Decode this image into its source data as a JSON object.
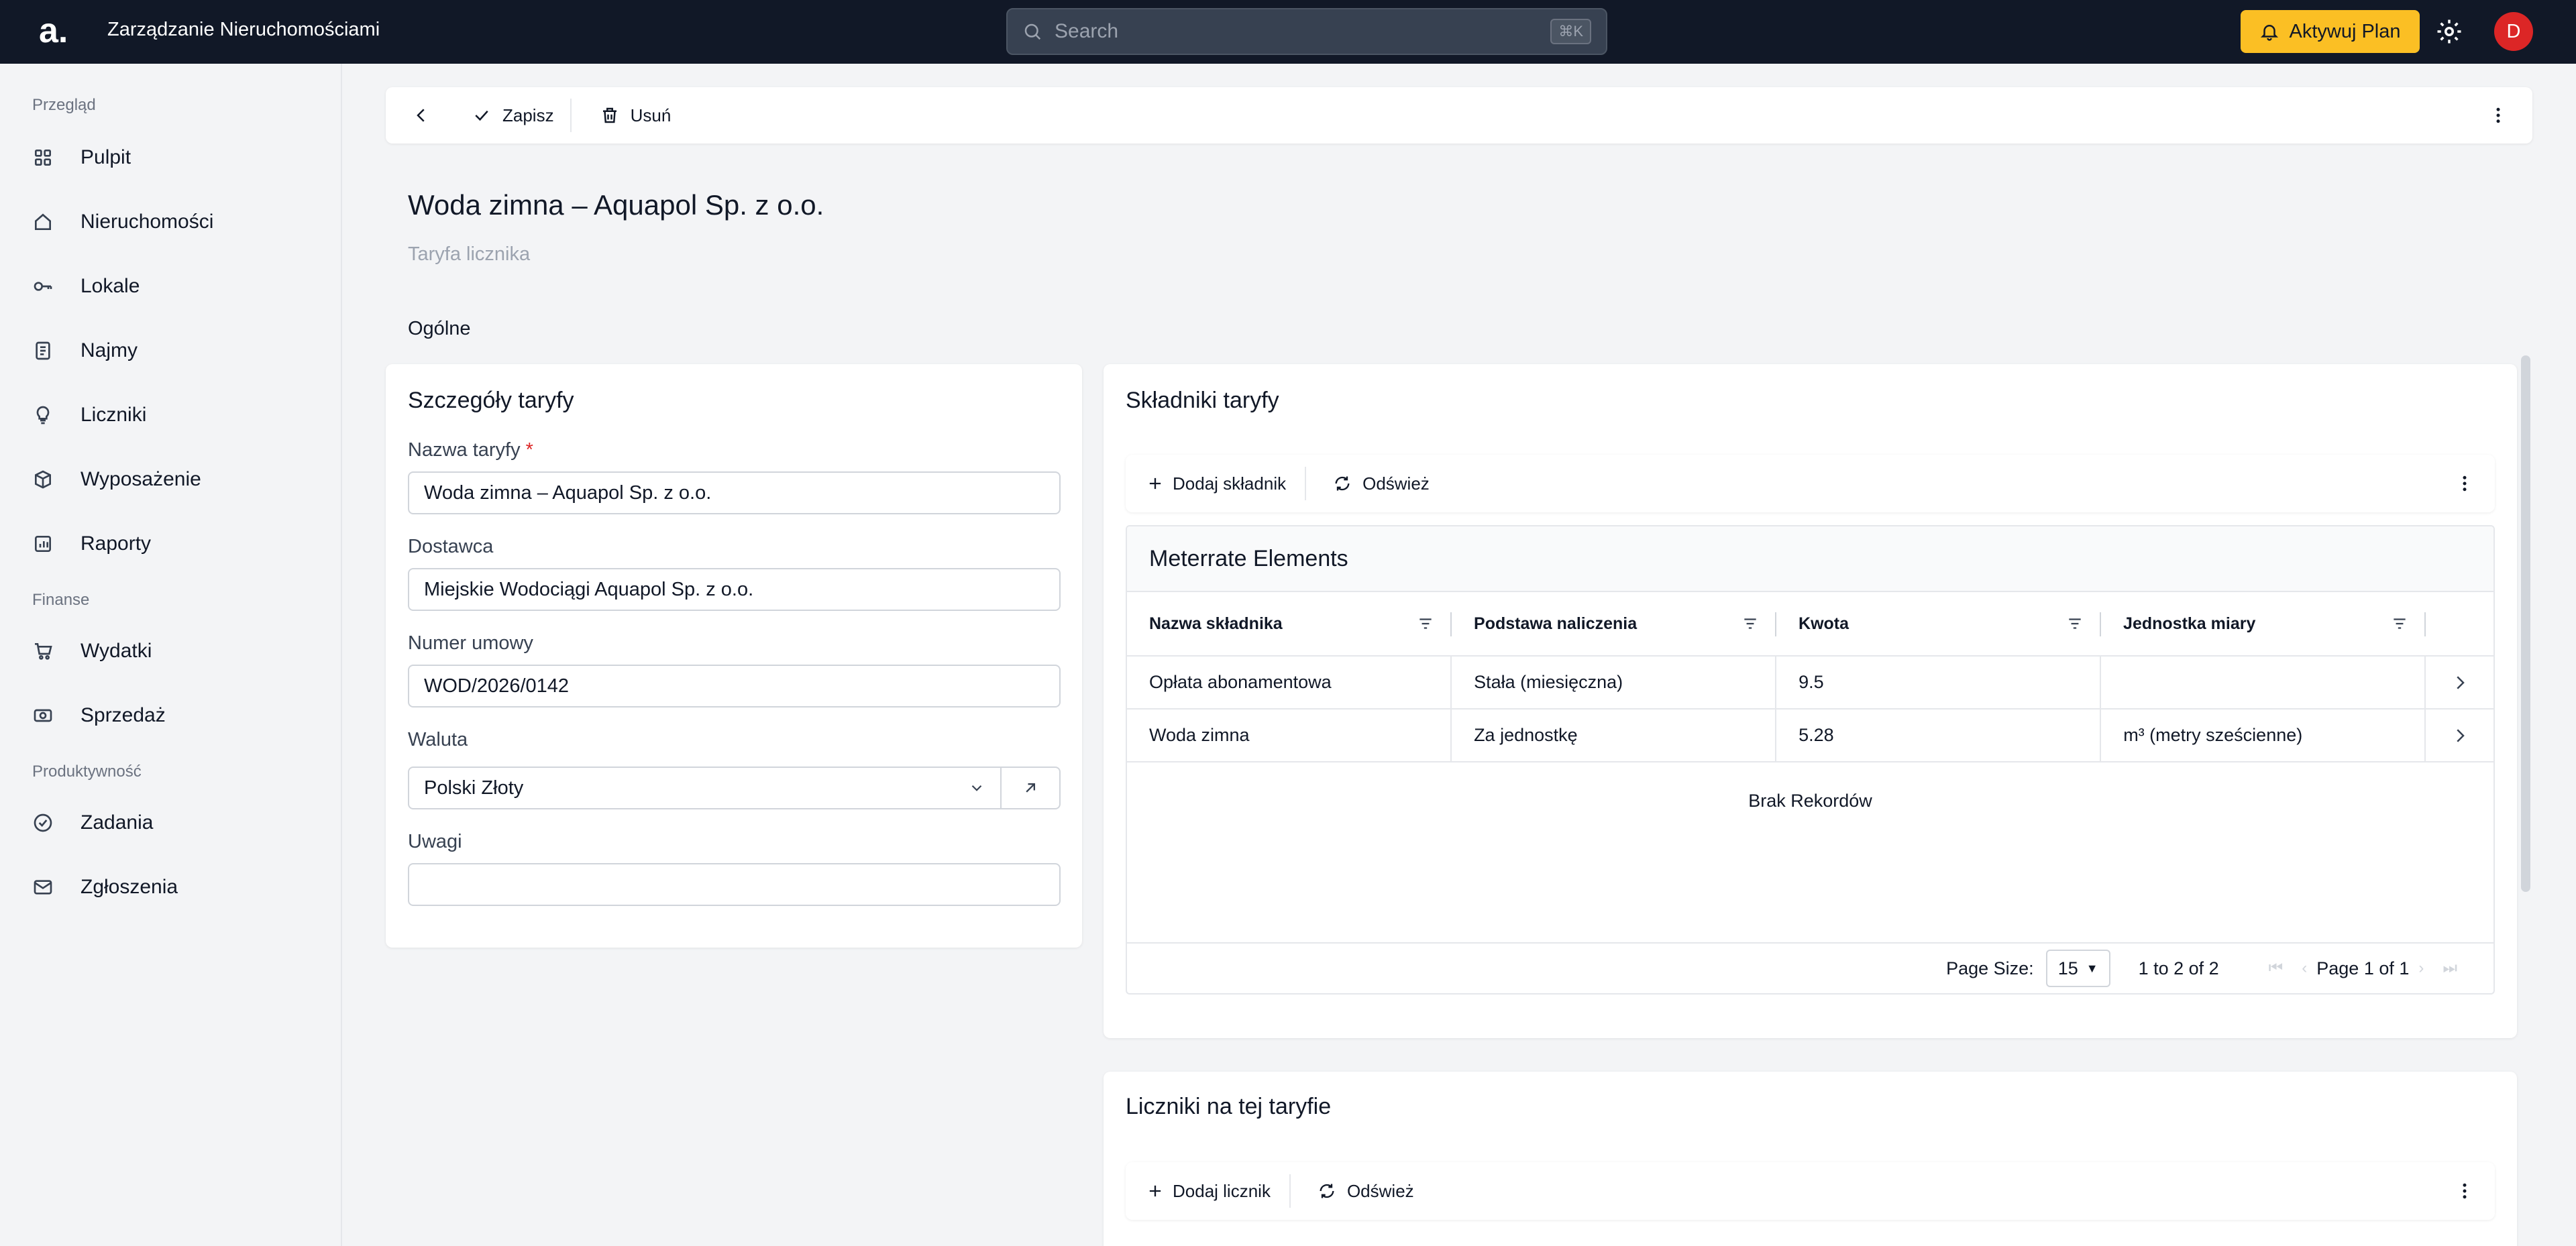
{
  "topbar": {
    "logo": "a.",
    "app_title": "Zarządzanie Nieruchomościami",
    "search_placeholder": "Search",
    "search_shortcut": "⌘K",
    "plan_button": "Aktywuj Plan",
    "avatar_initial": "D"
  },
  "sidebar": {
    "sections": [
      {
        "label": "Przegląd",
        "items": [
          "Pulpit",
          "Nieruchomości",
          "Lokale",
          "Najmy",
          "Liczniki",
          "Wyposażenie",
          "Raporty"
        ]
      },
      {
        "label": "Finanse",
        "items": [
          "Wydatki",
          "Sprzedaż"
        ]
      },
      {
        "label": "Produktywność",
        "items": [
          "Zadania",
          "Zgłoszenia"
        ]
      }
    ]
  },
  "toolbar": {
    "save_label": "Zapisz",
    "delete_label": "Usuń"
  },
  "page": {
    "title": "Woda zimna – Aquapol Sp. z o.o.",
    "subtitle": "Taryfa licznika",
    "section": "Ogólne"
  },
  "details": {
    "title": "Szczegóły taryfy",
    "name_label": "Nazwa taryfy",
    "name_required": "*",
    "name_value": "Woda zimna – Aquapol Sp. z o.o.",
    "supplier_label": "Dostawca",
    "supplier_value": "Miejskie Wodociągi Aquapol Sp. z o.o.",
    "contract_label": "Numer umowy",
    "contract_value": "WOD/2026/0142",
    "currency_label": "Waluta",
    "currency_value": "Polski Złoty",
    "notes_label": "Uwagi",
    "notes_value": ""
  },
  "components": {
    "title": "Składniki taryfy",
    "add_label": "Dodaj składnik",
    "refresh_label": "Odśwież",
    "grid_title": "Meterrate Elements",
    "columns": [
      "Nazwa składnika",
      "Podstawa naliczenia",
      "Kwota",
      "Jednostka miary"
    ],
    "rows": [
      [
        "Opłata abonamentowa",
        "Stała (miesięczna)",
        "9.5",
        ""
      ],
      [
        "Woda zimna",
        "Za jednostkę",
        "5.28",
        "m³ (metry sześcienne)"
      ]
    ],
    "empty_text": "Brak Rekordów",
    "page_size_label": "Page Size:",
    "page_size_value": "15",
    "range_text": "1 to 2 of 2",
    "page_text": "Page 1 of 1"
  },
  "meters": {
    "title": "Liczniki na tej taryfie",
    "add_label": "Dodaj licznik",
    "refresh_label": "Odśwież"
  },
  "colors": {
    "topbar": "#111827",
    "accent": "#fbbf24",
    "avatar": "#dc2626"
  }
}
